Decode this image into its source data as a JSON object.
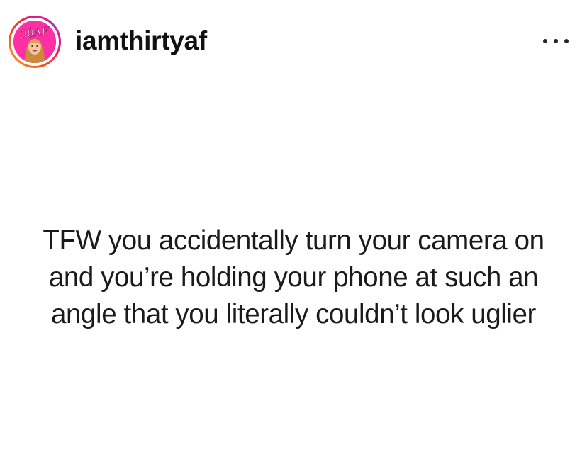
{
  "post": {
    "username": "iamthirtyaf",
    "avatar_text": "30AF",
    "more_icon": "ellipsis-horizontal-icon",
    "caption_lines": [
      "TFW you accidentally turn your camera on",
      "and you’re holding your phone at such an",
      "angle that you literally couldn’t look uglier"
    ]
  },
  "colors": {
    "avatar_background": "#ff2fa4",
    "story_ring": "gradient",
    "divider": "#dbdbdb",
    "text": "#111111"
  }
}
